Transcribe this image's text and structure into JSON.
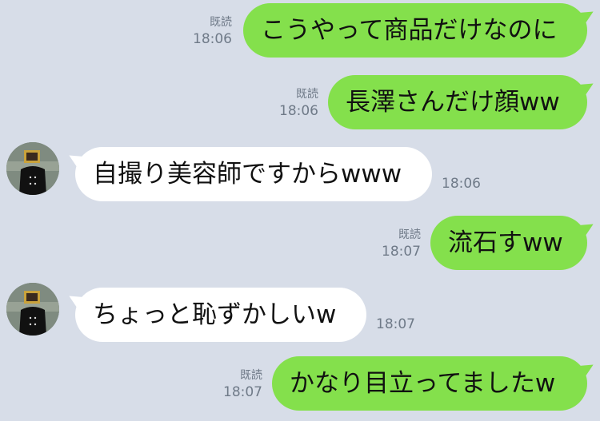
{
  "messages": [
    {
      "side": "out",
      "text": "こうやって商品だけなのに",
      "read": "既読",
      "time": "18:06"
    },
    {
      "side": "out",
      "text": "長澤さんだけ顔ww",
      "read": "既読",
      "time": "18:06"
    },
    {
      "side": "in",
      "text": "自撮り美容師ですからwww",
      "time": "18:06"
    },
    {
      "side": "out",
      "text": "流石すww",
      "read": "既読",
      "time": "18:07"
    },
    {
      "side": "in",
      "text": "ちょっと恥ずかしいw",
      "time": "18:07"
    },
    {
      "side": "out",
      "text": "かなり目立ってましたw",
      "read": "既読",
      "time": "18:07"
    }
  ],
  "colors": {
    "background": "#d7dde8",
    "outgoing_bubble": "#84e04c",
    "incoming_bubble": "#ffffff",
    "meta_text": "#6f7a88"
  },
  "icons": {
    "avatar": "contact-avatar-icon"
  }
}
